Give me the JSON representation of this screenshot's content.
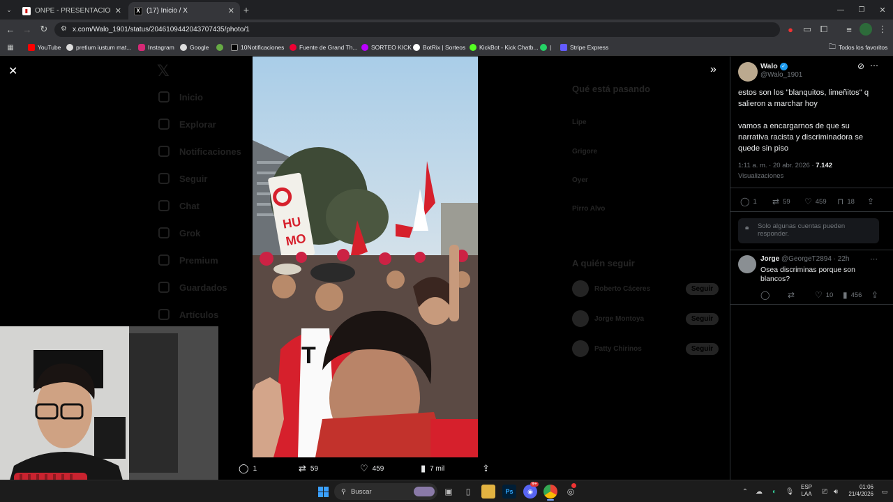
{
  "browser": {
    "tabs": [
      {
        "label": "ONPE - PRESENTACIÓN DE RES",
        "close": "✕"
      },
      {
        "label": "(17) Inicio / X",
        "close": "✕"
      }
    ],
    "new_tab": "+",
    "url": "x.com/Walo_1901/status/2046109442043707435/photo/1",
    "bookmarks": [
      "YouTube",
      "pretium iustum mat...",
      "Instagram",
      "Google",
      "10Notificaciones",
      "Fuente de Grand Th...",
      "SORTEO KICK",
      "BotRix | Sorteos",
      "KickBot - Kick Chatb...",
      "|",
      "Stripe Express"
    ],
    "all_favorites": "Todos los favoritos"
  },
  "background_nav": [
    "Inicio",
    "Explorar",
    "Notificaciones",
    "Seguir",
    "Chat",
    "Grok",
    "Premium",
    "Guardados",
    "Artículos"
  ],
  "background_right": {
    "trending_title": "Qué está pasando",
    "trends": [
      "Lipe",
      "Grigore",
      "Oyer",
      "Pirro Alvo"
    ],
    "follow_title": "A quién seguir",
    "suggestions": [
      "Roberto Cáceres",
      "Jorge Montoya",
      "Patty Chirinos"
    ],
    "follow_button": "Seguir"
  },
  "media_bar": {
    "replies": "1",
    "reposts": "59",
    "likes": "459",
    "views": "7 mil"
  },
  "tweet": {
    "author": "Walo",
    "handle": "@Walo_1901",
    "text1": "estos son los \"blanquitos, limeñitos\" q salieron a marchar hoy",
    "text2": "vamos a encargarnos de que su narrativa racista y discriminadora se quede sin piso",
    "timestamp": "1:11 a. m. · 20 abr. 2026 · ",
    "views_count": "7.142",
    "views_label": "Visualizaciones",
    "replies": "1",
    "reposts": "59",
    "likes": "459",
    "bookmarks": "18",
    "reply_restriction": "Solo algunas cuentas pueden responder."
  },
  "reply": {
    "author": "Jorge",
    "handle": "@GeorgeT2894 · 22h",
    "text": "Osea discriminas porque son blancos?",
    "likes": "10",
    "views": "456"
  },
  "taskbar": {
    "search": "Buscar",
    "lang1": "ESP",
    "lang2": "LAA",
    "time": "01:06",
    "date": "21/4/2026",
    "badge": "9+"
  },
  "colors": {
    "accent": "#1d9bf0",
    "peru_red": "#d6202c"
  }
}
